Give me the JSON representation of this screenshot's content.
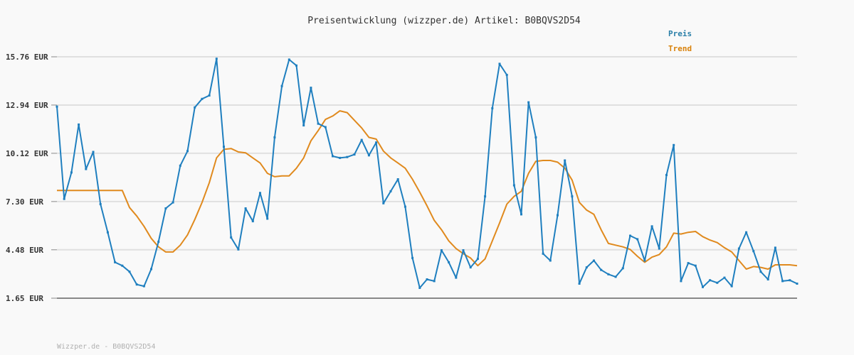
{
  "colors": {
    "background": "#f9f9f9",
    "grid": "#e0e0e0",
    "axis": "#888888",
    "price": "#1f7fbf",
    "trend": "#e08a1e",
    "legend_price": "#2a7fa8",
    "legend_trend": "#d9820b"
  },
  "footer_text": "Wizzper.de - B0BQVS2D54",
  "chart_data": {
    "type": "line",
    "title": "Preisentwicklung (wizzper.de) Artikel: B0BQVS2D54",
    "xlabel": "",
    "ylabel": "",
    "ylim": [
      1.65,
      15.76
    ],
    "y_ticks": [
      1.65,
      4.48,
      7.3,
      10.12,
      12.94,
      15.76
    ],
    "y_tick_labels": [
      "1.65 EUR",
      "4.48 EUR",
      "7.30 EUR",
      "10.12 EUR",
      "12.94 EUR",
      "15.76 EUR"
    ],
    "grid": true,
    "legend_position": "top-right",
    "series": [
      {
        "name": "Preis",
        "color": "#1f7fbf",
        "markers": true,
        "values": [
          12.85,
          7.45,
          9.0,
          11.8,
          9.2,
          10.2,
          7.15,
          5.5,
          3.75,
          3.55,
          3.2,
          2.45,
          2.35,
          3.35,
          4.95,
          6.9,
          7.25,
          9.4,
          10.25,
          12.8,
          13.3,
          13.5,
          15.65,
          10.5,
          5.2,
          4.5,
          6.9,
          6.15,
          7.8,
          6.3,
          11.05,
          14.05,
          15.6,
          15.25,
          11.75,
          13.95,
          11.85,
          11.65,
          9.95,
          9.85,
          9.9,
          10.05,
          10.9,
          10.0,
          10.75,
          7.2,
          7.9,
          8.6,
          7.0,
          4.0,
          2.25,
          2.75,
          2.65,
          4.45,
          3.75,
          2.85,
          4.45,
          3.45,
          3.95,
          7.6,
          12.75,
          15.35,
          14.7,
          8.25,
          6.55,
          13.1,
          11.05,
          4.25,
          3.85,
          6.5,
          9.7,
          7.6,
          2.5,
          3.45,
          3.85,
          3.3,
          3.05,
          2.9,
          3.4,
          5.3,
          5.1,
          3.85,
          5.85,
          4.55,
          8.85,
          10.6,
          2.65,
          3.7,
          3.55,
          2.3,
          2.7,
          2.55,
          2.85,
          2.35,
          4.55,
          5.5,
          4.4,
          3.2,
          2.75,
          4.6,
          2.65,
          2.7,
          2.5
        ]
      },
      {
        "name": "Trend",
        "color": "#e08a1e",
        "markers": false,
        "values": [
          7.95,
          7.95,
          7.95,
          7.95,
          7.95,
          7.95,
          7.95,
          7.95,
          7.95,
          7.95,
          6.95,
          6.45,
          5.85,
          5.15,
          4.65,
          4.35,
          4.35,
          4.75,
          5.35,
          6.25,
          7.25,
          8.4,
          9.85,
          10.35,
          10.4,
          10.2,
          10.15,
          9.85,
          9.55,
          8.95,
          8.75,
          8.8,
          8.8,
          9.25,
          9.85,
          10.85,
          11.45,
          12.1,
          12.3,
          12.6,
          12.5,
          12.05,
          11.6,
          11.05,
          10.95,
          10.25,
          9.85,
          9.55,
          9.25,
          8.6,
          7.85,
          7.05,
          6.2,
          5.65,
          5.0,
          4.55,
          4.25,
          4.0,
          3.55,
          3.95,
          5.0,
          6.05,
          7.15,
          7.6,
          7.9,
          8.95,
          9.65,
          9.7,
          9.7,
          9.6,
          9.25,
          8.55,
          7.25,
          6.8,
          6.55,
          5.65,
          4.85,
          4.75,
          4.65,
          4.5,
          4.1,
          3.75,
          4.05,
          4.2,
          4.65,
          5.45,
          5.4,
          5.5,
          5.55,
          5.25,
          5.05,
          4.9,
          4.6,
          4.35,
          3.85,
          3.35,
          3.5,
          3.45,
          3.35,
          3.6,
          3.6,
          3.6,
          3.55
        ]
      }
    ]
  }
}
